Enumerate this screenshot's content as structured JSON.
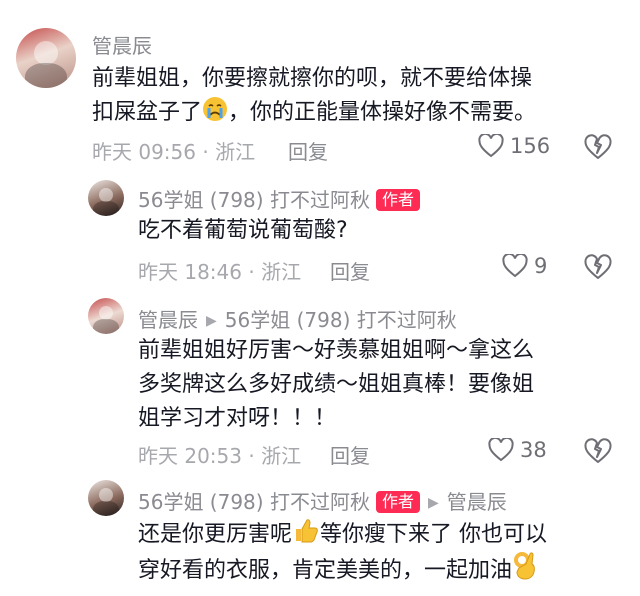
{
  "comments": [
    {
      "user": "管晨辰",
      "lines": [
        "前辈姐姐，你要擦就擦你的呗，就不要给体操",
        "扣屎盆子了",
        "，你的正能量体操好像不需要。"
      ],
      "emoji": "crying-face",
      "time": "昨天 09:56 · 浙江",
      "reply_label": "回复",
      "likes": "156"
    },
    {
      "user": "56学姐 (798) 打不过阿秋",
      "badge": "作者",
      "lines": [
        "吃不着葡萄说葡萄酸?"
      ],
      "time": "昨天 18:46 · 浙江",
      "reply_label": "回复",
      "likes": "9"
    },
    {
      "user": "管晨辰",
      "reply_to": "56学姐 (798) 打不过阿秋",
      "lines": [
        "前辈姐姐好厉害～好羡慕姐姐啊～拿这么",
        "多奖牌这么多好成绩～姐姐真棒！要像姐",
        "姐学习才对呀！！！"
      ],
      "time": "昨天 20:53 · 浙江",
      "reply_label": "回复",
      "likes": "38"
    },
    {
      "user": "56学姐 (798) 打不过阿秋",
      "badge": "作者",
      "reply_to": "管晨辰",
      "lines": [
        "还是你更厉害呢",
        "等你瘦下来了 你也可以",
        "穿好看的衣服，肯定美美的，一起加油"
      ],
      "emojis": [
        "thumbs-up",
        "ok-hand"
      ]
    }
  ],
  "colors": {
    "badge": "#fe2c55",
    "meta": "#a7a8ad",
    "name": "#8a8b91",
    "text": "#161823"
  }
}
